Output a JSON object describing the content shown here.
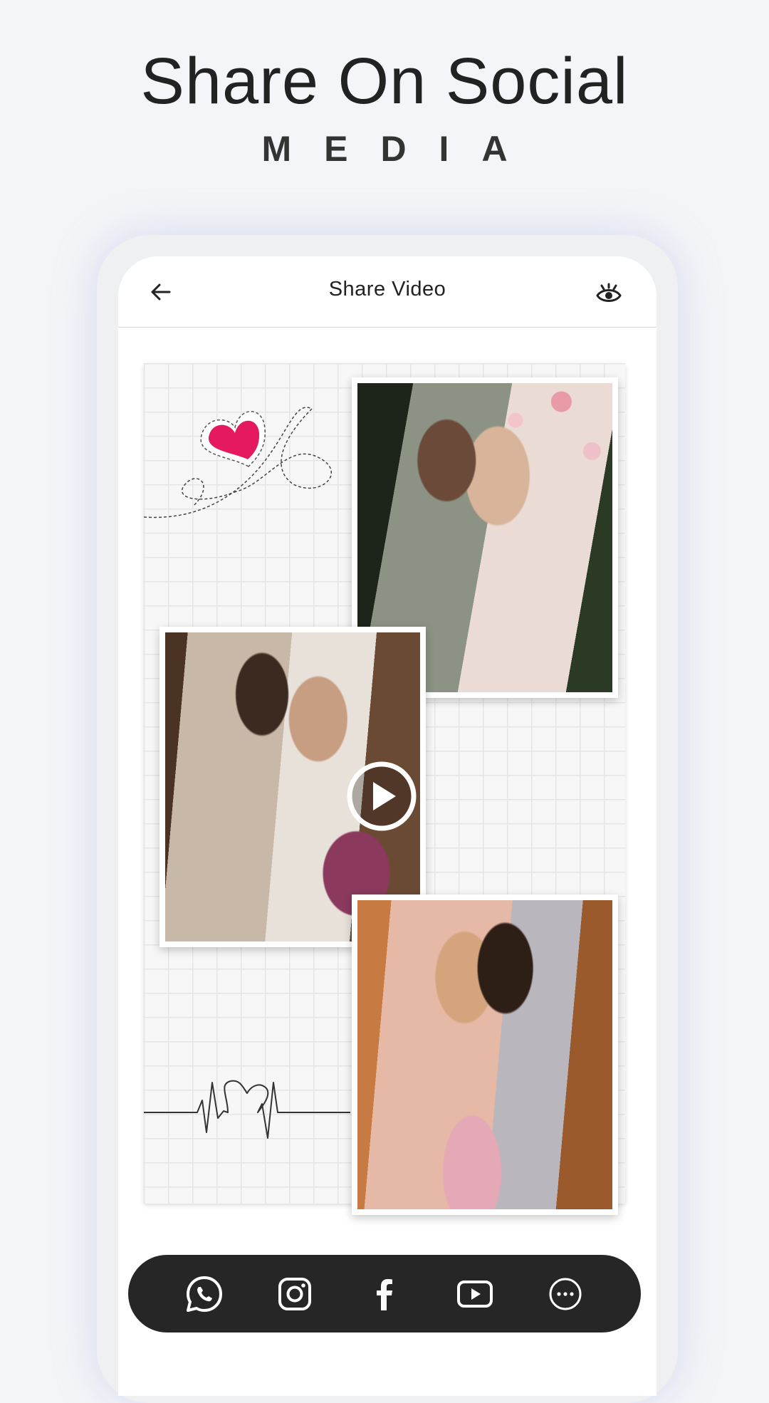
{
  "promo": {
    "headline": "Share On Social",
    "subheadline": "MEDIA"
  },
  "appbar": {
    "title": "Share Video",
    "back_icon": "arrow-left-icon",
    "preview_icon": "eye-icon"
  },
  "share_bar": {
    "items": [
      {
        "name": "whatsapp",
        "icon": "whatsapp-icon"
      },
      {
        "name": "instagram",
        "icon": "instagram-icon"
      },
      {
        "name": "facebook",
        "icon": "facebook-icon"
      },
      {
        "name": "youtube",
        "icon": "youtube-icon"
      },
      {
        "name": "more",
        "icon": "more-horizontal-icon"
      }
    ]
  },
  "colors": {
    "background": "#f4f5f8",
    "share_bar": "#262626",
    "heart": "#e5195f"
  }
}
